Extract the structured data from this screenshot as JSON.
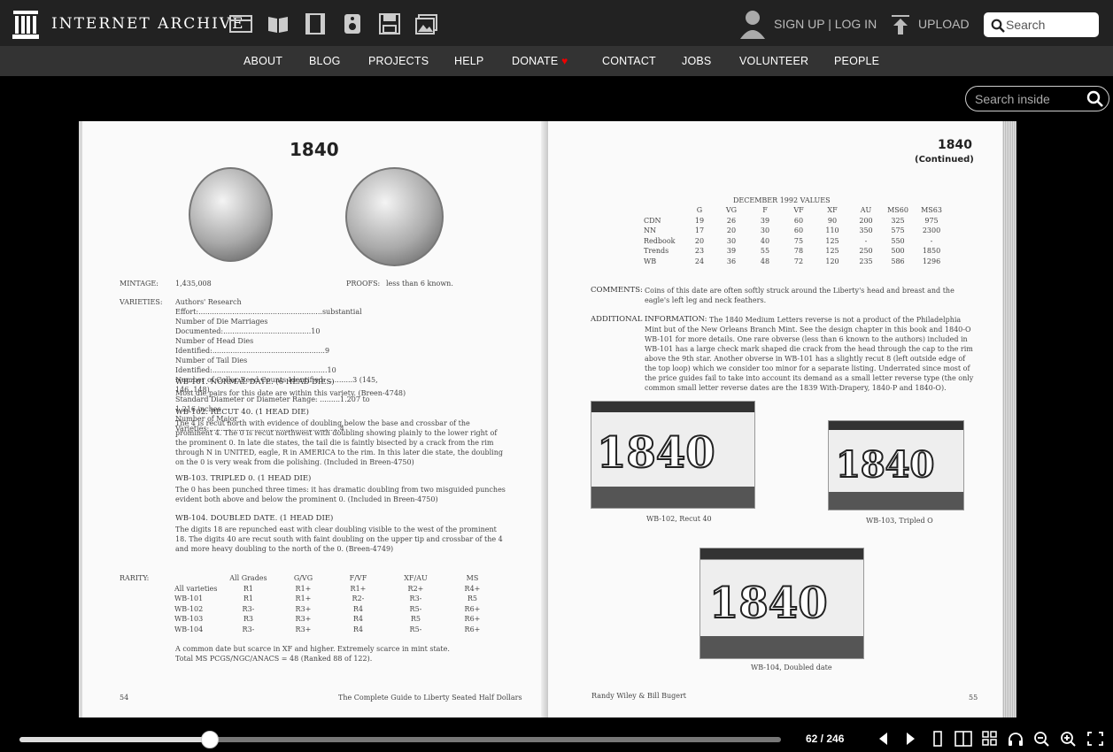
{
  "header": {
    "brand": "INTERNET ARCHIVE",
    "signup": "SIGN UP | LOG IN",
    "upload": "UPLOAD",
    "search_placeholder": "Search",
    "media_icons": [
      "web-icon",
      "texts-icon",
      "video-icon",
      "audio-icon",
      "software-icon",
      "images-icon"
    ]
  },
  "nav": [
    "ABOUT",
    "BLOG",
    "PROJECTS",
    "HELP",
    "DONATE",
    "CONTACT",
    "JOBS",
    "VOLUNTEER",
    "PEOPLE"
  ],
  "viewer": {
    "search_inside_placeholder": "Search inside"
  },
  "left_page": {
    "year": "1840",
    "mintage_label": "MINTAGE:",
    "mintage_value": "1,435,008",
    "proofs_label": "PROOFS:",
    "proofs_value": "less than 6 known.",
    "varieties_label": "VARIETIES:",
    "varieties_lines": [
      "Authors' Research Effort:.......................................................substantial",
      "Number of Die Marriages Documented:.......................................10",
      "Number of Head Dies Identified:..................................................9",
      "Number of Tail Dies Identified:...................................................10",
      "Number of Collar Reed Counts Identified: ...........3 (145, 146, 148)",
      "Standard Diameter or Diameter Range: .........1.207 to 1.216 inches",
      "Number of Major Varieties:..........................................................4"
    ],
    "entries": [
      {
        "title": "WB-101.  NORMAL DATE.  (6 HEAD DIES)",
        "body": "Most die pairs for this date are within this variety.  (Breen-4748)"
      },
      {
        "title": "WB-102.  RECUT 40.  (1 HEAD DIE)",
        "body": "The 4 is recut north with evidence of doubling below the base and crossbar of the prominent 4.  The 0 is recut northwest with doubling showing plainly to the lower right of the prominent 0.  In late die states, the tail die is faintly bisected by a crack from the rim through N in UNITED, eagle, R in AMERICA to the rim.  In this later die state, the doubling on the 0 is very weak from die polishing. (Included in Breen-4750)"
      },
      {
        "title": "WB-103.  TRIPLED 0.  (1 HEAD DIE)",
        "body": "The 0 has been punched three times:  it has dramatic doubling from two misguided punches evident both above and below the prominent 0.  (Included in Breen-4750)"
      },
      {
        "title": "WB-104.  DOUBLED DATE.  (1 HEAD DIE)",
        "body": "The digits 18 are repunched east with clear doubling visible to the west of the prominent 18.  The digits 40 are recut south with faint doubling on the upper tip and crossbar of the 4 and more heavy doubling to the north of the 0.  (Breen-4749)"
      }
    ],
    "rarity_label": "RARITY:",
    "rarity_headers": [
      "",
      "All Grades",
      "G/VG",
      "F/VF",
      "XF/AU",
      "MS"
    ],
    "rarity_rows": [
      [
        "All varieties",
        "R1",
        "R1+",
        "R1+",
        "R2+",
        "R4+"
      ],
      [
        "WB-101",
        "R1",
        "R1+",
        "R2-",
        "R3-",
        "R5"
      ],
      [
        "WB-102",
        "R3-",
        "R3+",
        "R4",
        "R5-",
        "R6+"
      ],
      [
        "WB-103",
        "R3",
        "R3+",
        "R4",
        "R5",
        "R6+"
      ],
      [
        "WB-104",
        "R3-",
        "R3+",
        "R4",
        "R5-",
        "R6+"
      ]
    ],
    "rarity_note1": "A common date but scarce in XF and higher.  Extremely scarce in mint state.",
    "rarity_note2": "Total MS PCGS/NGC/ANACS = 48 (Ranked 88 of 122).",
    "page_number": "54",
    "footer": "The Complete Guide to Liberty Seated Half Dollars"
  },
  "right_page": {
    "year": "1840",
    "continued": "(Continued)",
    "values_title": "DECEMBER 1992 VALUES",
    "values_headers": [
      "",
      "G",
      "VG",
      "F",
      "VF",
      "XF",
      "AU",
      "MS60",
      "MS63"
    ],
    "values_rows": [
      [
        "CDN",
        "19",
        "26",
        "39",
        "60",
        "90",
        "200",
        "325",
        "975"
      ],
      [
        "NN",
        "17",
        "20",
        "30",
        "60",
        "110",
        "350",
        "575",
        "2300"
      ],
      [
        "Redbook",
        "20",
        "30",
        "40",
        "75",
        "125",
        "-",
        "550",
        "-"
      ],
      [
        "Trends",
        "23",
        "39",
        "55",
        "78",
        "125",
        "250",
        "500",
        "1850"
      ],
      [
        "WB",
        "24",
        "36",
        "48",
        "72",
        "120",
        "235",
        "586",
        "1296"
      ]
    ],
    "comments_label": "COMMENTS:",
    "comments_text": "Coins of this date are often softly struck around the Liberty's head and breast and the eagle's left leg and neck feathers.",
    "additional_label": "ADDITIONAL INFORMATION:",
    "additional_text": "The 1840 Medium Letters reverse is not a product of the Philadelphia Mint but of the New Orleans Branch Mint.  See the design chapter in this book and 1840-O WB-101 for more details. One rare obverse (less than 6 known to the authors) included in WB-101 has a large check mark shaped die crack from the head through the cap to the rim above the 9th star.  Another obverse in WB-101 has a slightly recut 8 (left outside edge of the top loop) which we consider too minor for a separate listing. Underrated since most of the price guides fail to take into account its demand as a small letter reverse type (the only common small letter reverse dates are the 1839 With-Drapery, 1840-P and 1840-O).",
    "photos": [
      {
        "digits": "1840",
        "caption": "WB-102, Recut 40"
      },
      {
        "digits": "1840",
        "caption": "WB-103, Tripled O"
      },
      {
        "digits": "1840",
        "caption": "WB-104, Doubled date"
      }
    ],
    "footer_left": "Randy Wiley & Bill Bugert",
    "page_number": "55"
  },
  "bottom": {
    "page_indicator": "62 / 246",
    "progress": 0.25
  }
}
